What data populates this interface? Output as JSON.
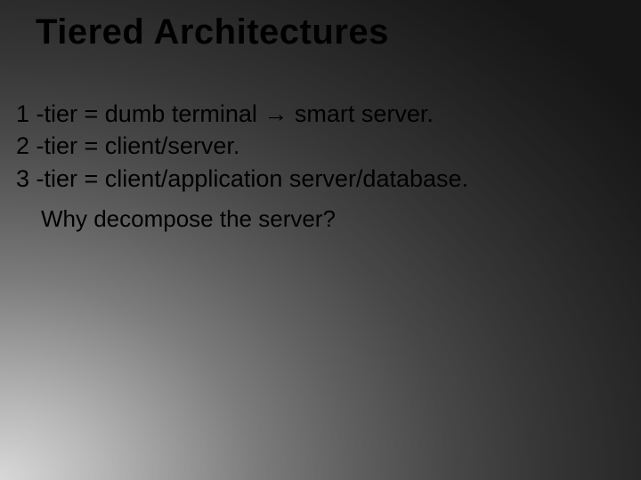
{
  "title": "Tiered Architectures",
  "lines": {
    "l1_pre": "1 -tier = dumb terminal ",
    "l1_arrow": "→",
    "l1_post": " smart server.",
    "l2": "2 -tier = client/server.",
    "l3": "3 -tier = client/application server/database."
  },
  "question": "Why decompose the server?"
}
